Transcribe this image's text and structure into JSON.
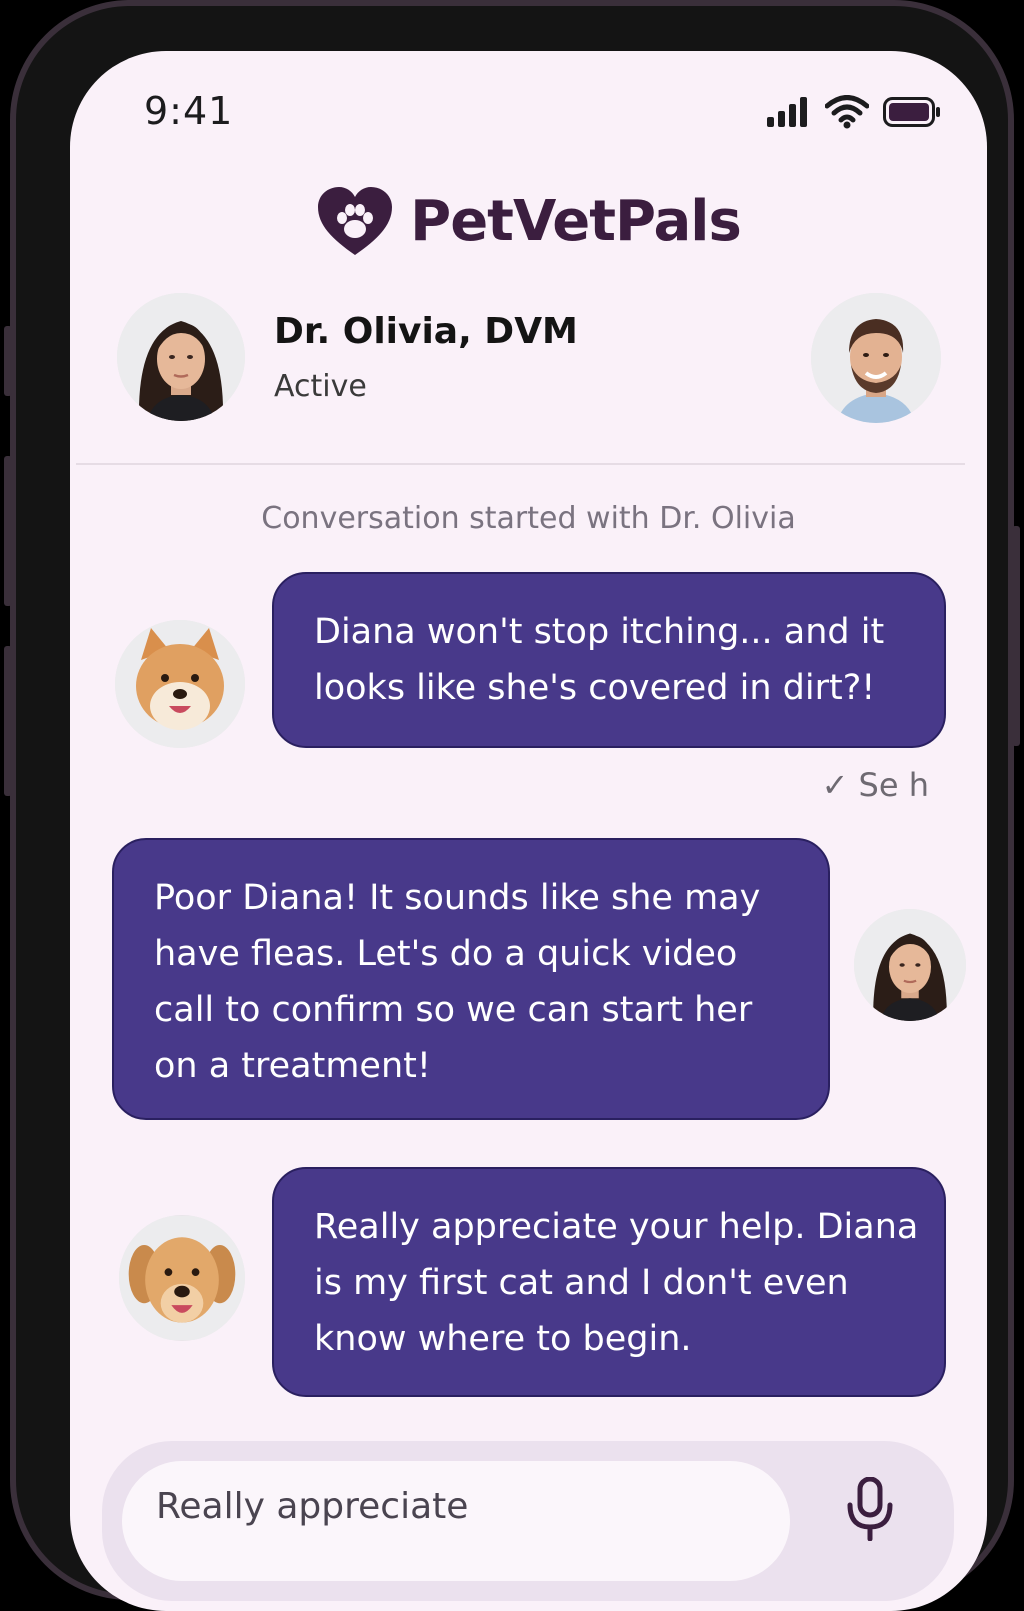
{
  "status_bar": {
    "time": "9:41",
    "icons": [
      "signal-icon",
      "wifi-icon",
      "battery-icon"
    ]
  },
  "brand": {
    "name": "PetVetPals",
    "logo": "heart-paw-icon"
  },
  "chat_header": {
    "contact_name": "Dr. Olivia, DVM",
    "contact_status": "Active"
  },
  "conversation": {
    "system_note": "Conversation started with Dr. Olivia",
    "messages": [
      {
        "from": "user",
        "text": "Diana won't stop itching... and it looks like she's covered in dirt?!"
      },
      {
        "from": "vet",
        "text": "Poor Diana! It sounds like she may have fleas. Let's do a quick video call to confirm so we can start her on a treatment!"
      },
      {
        "from": "user",
        "text": "Really appreciate your help. Diana is my first cat and I don't even know where to begin."
      }
    ],
    "receipt": {
      "check": "✓",
      "text": "Se h"
    }
  },
  "composer": {
    "value": "Really appreciate",
    "mic_icon": "microphone-icon"
  },
  "colors": {
    "bubble": "#48398a",
    "background": "#faf1f9",
    "brand": "#3b1e3f"
  }
}
